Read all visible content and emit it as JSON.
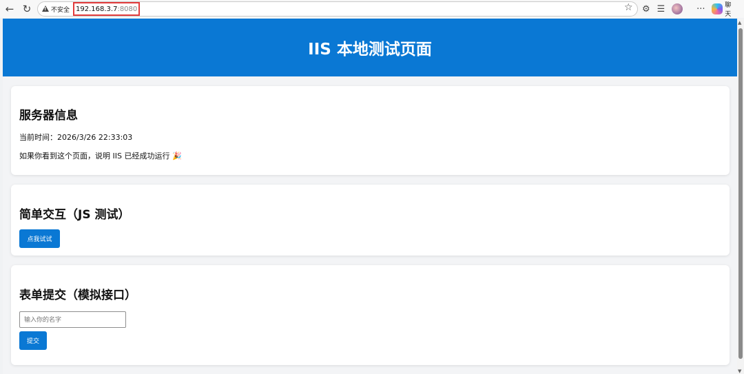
{
  "browser": {
    "security_label": "不安全",
    "url_host": "192.168.3.7",
    "url_port": ":8080",
    "chat_label": "聊天",
    "more_label": "···"
  },
  "header": {
    "title": "IIS 本地测试页面",
    "bg_color": "#0a78d4"
  },
  "server_info": {
    "heading": "服务器信息",
    "time_label": "当前时间：2026/3/26 22:33:03",
    "message": "如果你看到这个页面，说明 IIS 已经成功运行 🎉"
  },
  "interaction": {
    "heading": "简单交互（JS 测试）",
    "button_label": "点我试试"
  },
  "form": {
    "heading": "表单提交（模拟接口）",
    "input_placeholder": "输入你的名字",
    "input_value": "",
    "submit_label": "提交"
  },
  "colors": {
    "accent": "#0a78d4",
    "url_highlight": "#e23b3b"
  }
}
